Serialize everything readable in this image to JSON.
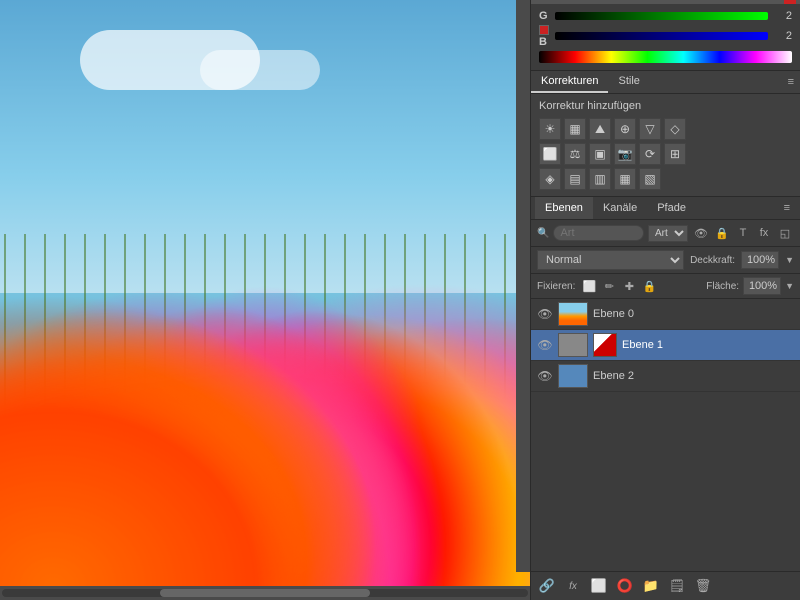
{
  "panel": {
    "channels": {
      "g_label": "G",
      "g_value": "2",
      "b_label": "B",
      "b_value": "2"
    },
    "tabs": {
      "korrekturen": "Korrekturen",
      "stile": "Stile",
      "korrektur_title": "Korrektur hinzufügen"
    },
    "layers_tabs": {
      "ebenen": "Ebenen",
      "kanaele": "Kanäle",
      "pfade": "Pfade"
    },
    "search": {
      "placeholder": "Art",
      "value": ""
    },
    "blend": {
      "mode": "Normal",
      "opacity_label": "Deckkraft:",
      "opacity_value": "100%",
      "flaeche_label": "Fläche:",
      "flaeche_value": "100%"
    },
    "fixieren": {
      "label": "Fixieren:"
    },
    "layers": [
      {
        "name": "Ebene 0",
        "visible": true,
        "selected": false,
        "type": "image"
      },
      {
        "name": "Ebene 1",
        "visible": true,
        "selected": true,
        "type": "mask"
      },
      {
        "name": "Ebene 2",
        "visible": true,
        "selected": false,
        "type": "solid"
      }
    ],
    "bottom_icons": [
      "🔗",
      "fx",
      "🔲",
      "⭕",
      "📁",
      "🗑"
    ]
  }
}
